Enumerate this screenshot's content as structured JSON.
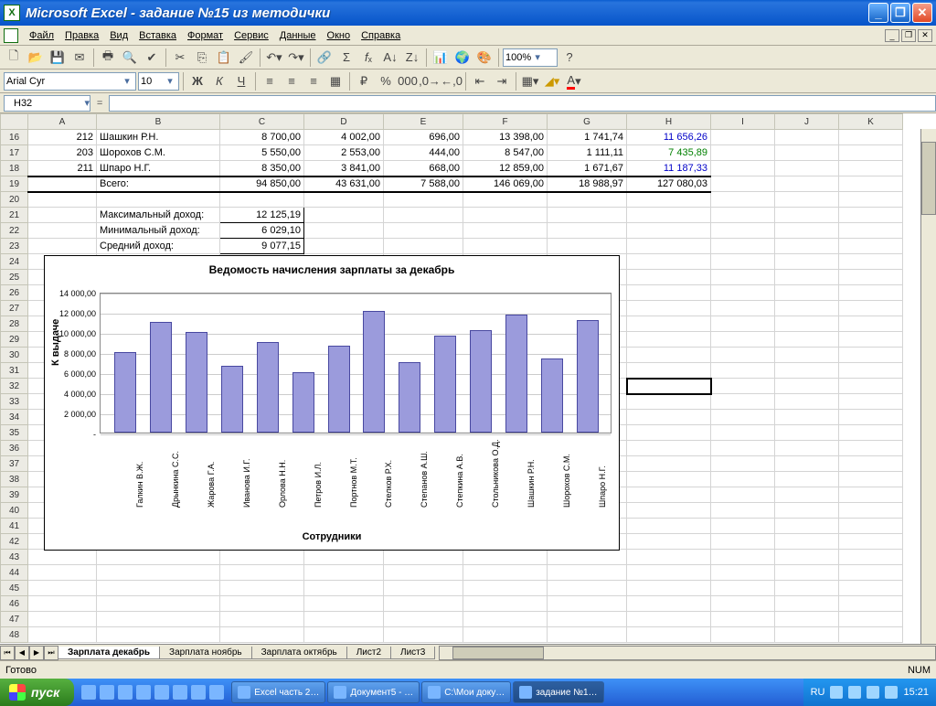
{
  "window": {
    "title": "Microsoft Excel - задание №15 из методички"
  },
  "menu": [
    "Файл",
    "Правка",
    "Вид",
    "Вставка",
    "Формат",
    "Сервис",
    "Данные",
    "Окно",
    "Справка"
  ],
  "toolbar1": {
    "zoom": "100%"
  },
  "fmtbar": {
    "font": "Arial Cyr",
    "size": "10"
  },
  "namebox": "H32",
  "columns": [
    "A",
    "B",
    "C",
    "D",
    "E",
    "F",
    "G",
    "H",
    "I",
    "J",
    "K"
  ],
  "startRow": 16,
  "rows": [
    {
      "A": "212",
      "B": "Шашкин Р.Н.",
      "C": "8 700,00",
      "D": "4 002,00",
      "E": "696,00",
      "F": "13 398,00",
      "G": "1 741,74",
      "H": "11 656,26",
      "Hc": "#0000c8"
    },
    {
      "A": "203",
      "B": "Шорохов С.М.",
      "C": "5 550,00",
      "D": "2 553,00",
      "E": "444,00",
      "F": "8 547,00",
      "G": "1 111,11",
      "H": "7 435,89",
      "Hc": "#008000"
    },
    {
      "A": "211",
      "B": "Шпаро Н.Г.",
      "C": "8 350,00",
      "D": "3 841,00",
      "E": "668,00",
      "F": "12 859,00",
      "G": "1 671,67",
      "H": "11 187,33",
      "Hc": "#0000c8"
    },
    {
      "A": "",
      "B": "Всего:",
      "C": "94 850,00",
      "D": "43 631,00",
      "E": "7 588,00",
      "F": "146 069,00",
      "G": "18 988,97",
      "H": "127 080,03",
      "Hc": "#000"
    }
  ],
  "summary": [
    {
      "label": "Максимальный доход:",
      "val": "12 125,19"
    },
    {
      "label": "Минимальный доход:",
      "val": "6 029,10"
    },
    {
      "label": "Средний доход:",
      "val": "9 077,15"
    }
  ],
  "chart_data": {
    "type": "bar",
    "title": "Ведомость начисления зарплаты за декабрь",
    "ylabel": "К выдаче",
    "xlabel": "Сотрудники",
    "ylim": [
      0,
      14000
    ],
    "yticks": [
      "-",
      "2 000,00",
      "4 000,00",
      "6 000,00",
      "8 000,00",
      "10 000,00",
      "12 000,00",
      "14 000,00"
    ],
    "categories": [
      "Галкин В.Ж.",
      "Дрынкина С.С.",
      "Жарова Г.А.",
      "Иванова И.Г.",
      "Орлова Н.Н.",
      "Петров И.Л.",
      "Портнов М.Т.",
      "Стелков Р.Х.",
      "Степанов А.Ш.",
      "Степкина А.В.",
      "Стольникова О.Д.",
      "Шашкин Р.Н.",
      "Шорохов С.М.",
      "Шпаро Н.Г."
    ],
    "values": [
      8000,
      11000,
      10000,
      6600,
      9000,
      6000,
      8600,
      12100,
      7000,
      9600,
      10200,
      11700,
      7400,
      11200
    ]
  },
  "tabs": [
    "Зарплата декабрь",
    "Зарплата ноябрь",
    "Зарплата октябрь",
    "Лист2",
    "Лист3"
  ],
  "activeTab": 0,
  "status": {
    "left": "Готово",
    "num": "NUM"
  },
  "taskbar": {
    "start": "пуск",
    "tasks": [
      "Excel часть 2…",
      "Документ5 - …",
      "С:\\Мои доку…",
      "задание №1…"
    ],
    "activeTask": 3,
    "lang": "RU",
    "clock": "15:21"
  }
}
